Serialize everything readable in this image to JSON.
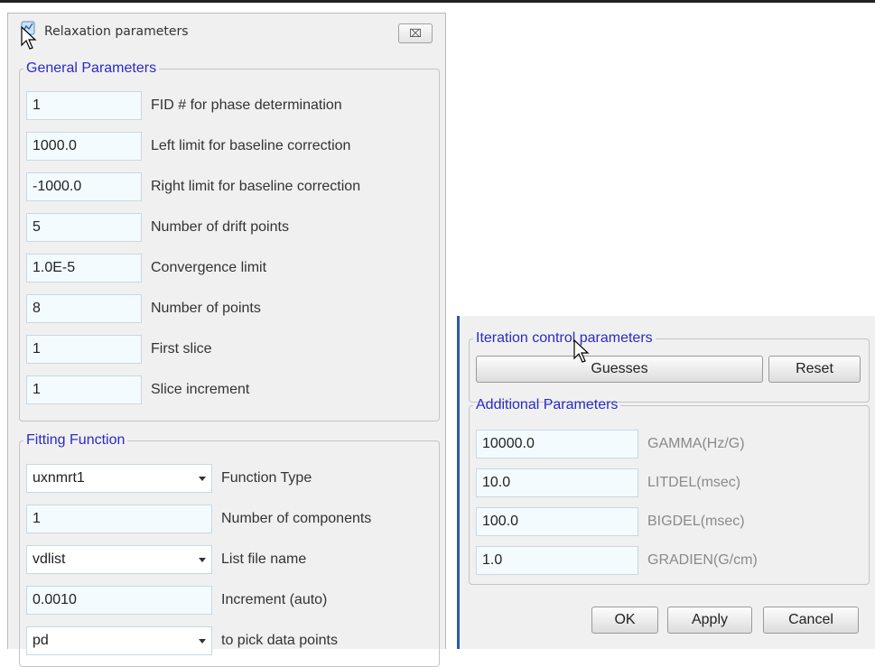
{
  "left_dialog": {
    "title": "Relaxation parameters",
    "close_symbol": "⌧",
    "general": {
      "legend": "General Parameters",
      "rows": [
        {
          "value": "1",
          "label": "FID # for phase determination"
        },
        {
          "value": "1000.0",
          "label": "Left limit for baseline correction"
        },
        {
          "value": "-1000.0",
          "label": "Right limit for baseline correction"
        },
        {
          "value": "5",
          "label": "Number of drift points"
        },
        {
          "value": "1.0E-5",
          "label": "Convergence limit"
        },
        {
          "value": "8",
          "label": "Number of points"
        },
        {
          "value": "1",
          "label": "First slice"
        },
        {
          "value": "1",
          "label": "Slice increment"
        }
      ]
    },
    "fitting": {
      "legend": "Fitting Function",
      "rows": [
        {
          "value": "uxnmrt1",
          "label": "Function Type"
        },
        {
          "value": "1",
          "label": "Number of components"
        },
        {
          "value": "vdlist",
          "label": "List file name"
        },
        {
          "value": "0.0010",
          "label": "Increment (auto)"
        },
        {
          "value": "pd",
          "label": "to pick data points"
        }
      ]
    }
  },
  "right_dialog": {
    "iteration": {
      "legend": "Iteration control parameters",
      "guesses_label": "Guesses",
      "reset_label": "Reset"
    },
    "additional": {
      "legend": "Additional Parameters",
      "rows": [
        {
          "value": "10000.0",
          "label": "GAMMA(Hz/G)"
        },
        {
          "value": "10.0",
          "label": "LITDEL(msec)"
        },
        {
          "value": "100.0",
          "label": "BIGDEL(msec)"
        },
        {
          "value": "1.0",
          "label": "GRADIEN(G/cm)"
        }
      ]
    },
    "buttons": {
      "ok": "OK",
      "apply": "Apply",
      "cancel": "Cancel"
    }
  },
  "colors": {
    "legend": "#2a2ac8",
    "field_bg": "#f3fbfe",
    "dialog_bg": "#f0f0f0",
    "accent_border": "#2c5aa8"
  }
}
